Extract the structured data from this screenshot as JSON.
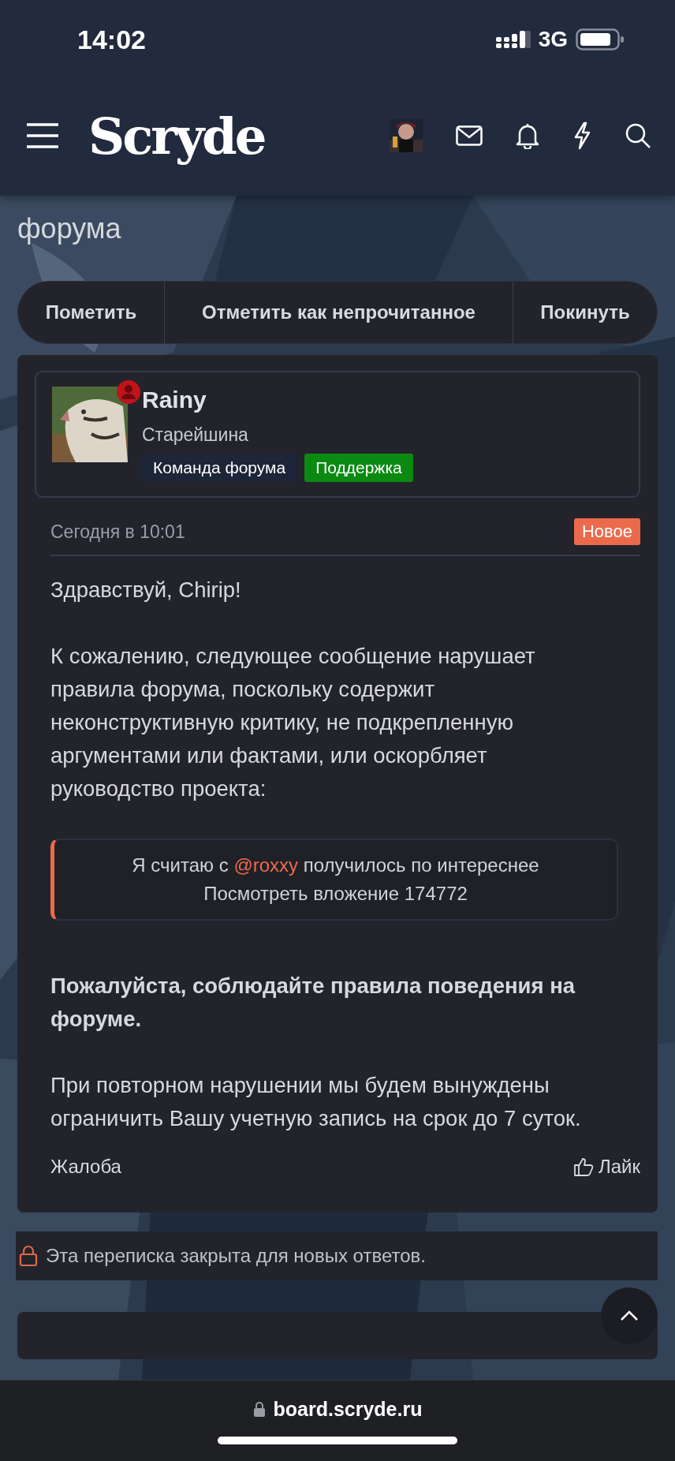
{
  "status_bar": {
    "time": "14:02",
    "network": "3G"
  },
  "header": {
    "logo": "Scryde"
  },
  "thread": {
    "title": "форума",
    "actions": [
      {
        "label": "Пометить"
      },
      {
        "label": "Отметить как непрочитанное"
      },
      {
        "label": "Покинуть"
      }
    ]
  },
  "post": {
    "author": {
      "name": "Rainy",
      "rank": "Старейшина",
      "banners": [
        {
          "label": "Команда форума",
          "color": "#1d2538"
        },
        {
          "label": "Поддержка",
          "color": "#0b8a12"
        }
      ]
    },
    "date": "Сегодня в 10:01",
    "badge": "Новое",
    "blocks": [
      {
        "kind": "plain",
        "text": "Здравствуй, Chirip!"
      },
      {
        "kind": "plain",
        "text": "К сожалению, следующее сообщение нарушает правила форума, поскольку содержит неконструктивную критику, не подкрепленную аргументами или фактами, или оскорбляет руководство проекта:"
      },
      {
        "kind": "quote",
        "before": "Я считаю с",
        "mention": "@roxxy",
        "after": "получилось по интереснее",
        "line2": "Посмотреть вложение 174772"
      },
      {
        "kind": "strong",
        "text": "Пожалуйста, соблюдайте правила поведения на форуме."
      },
      {
        "kind": "plain",
        "text": "При повторном нарушении мы будем вынуждены ограничить Вашу учетную запись на срок до 7 суток."
      }
    ],
    "report": "Жалоба",
    "like": "Лайк"
  },
  "locked_notice": "Эта переписка закрыта для новых ответов.",
  "browser": {
    "url": "board.scryde.ru"
  }
}
